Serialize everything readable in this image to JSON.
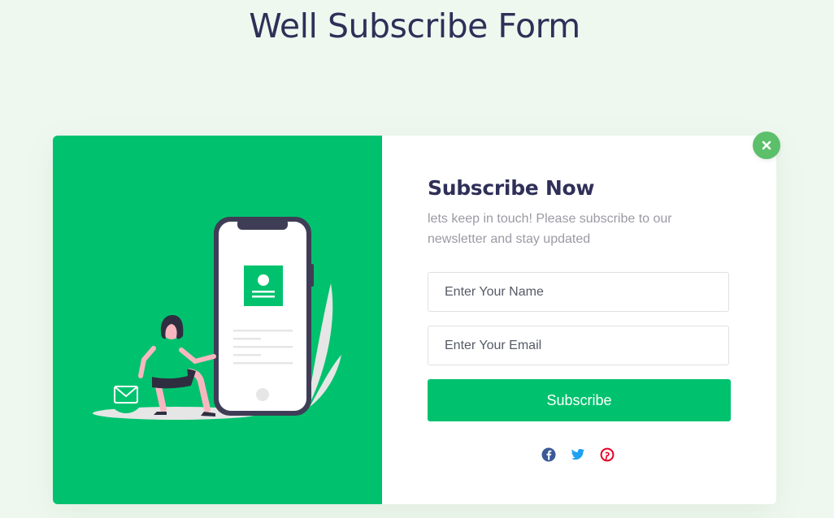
{
  "page": {
    "title": "Well Subscribe Form"
  },
  "modal": {
    "title": "Subscribe Now",
    "subtitle": "lets keep in touch! Please subscribe to our newsletter and stay updated",
    "name_placeholder": "Enter Your Name",
    "email_placeholder": "Enter Your Email",
    "submit_label": "Subscribe",
    "close_icon": "close-icon",
    "social": [
      {
        "name": "facebook-icon",
        "color": "#3b5998"
      },
      {
        "name": "twitter-icon",
        "color": "#1da1f2"
      },
      {
        "name": "pinterest-icon",
        "color": "#e60023"
      }
    ]
  },
  "colors": {
    "brand_green": "#00c26e",
    "page_background": "#eff8ef",
    "title_navy": "#2f3058",
    "close_button": "#5cbf6a"
  }
}
